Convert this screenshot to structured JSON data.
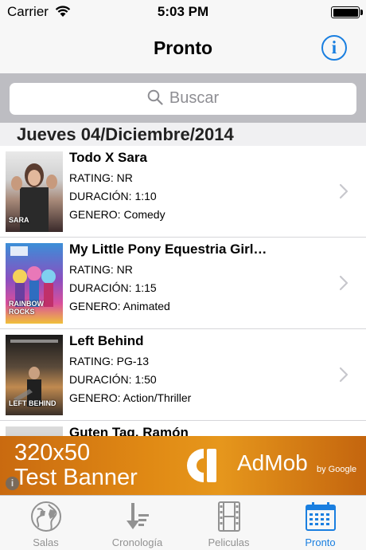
{
  "status_bar": {
    "carrier": "Carrier",
    "time": "5:03 PM"
  },
  "nav": {
    "title": "Pronto",
    "info_icon": "info-circle-icon"
  },
  "search": {
    "placeholder": "Buscar"
  },
  "section": {
    "header": "Jueves 04/Diciembre/2014"
  },
  "movies": [
    {
      "title": "Todo X Sara",
      "rating": "RATING: NR",
      "duration": "DURACIÓN: 1:10",
      "genre": "GENERO: Comedy",
      "poster_text": "SARA"
    },
    {
      "title": "My Little Pony Equestria Girl…",
      "rating": "RATING: NR",
      "duration": "DURACIÓN: 1:15",
      "genre": "GENERO: Animated",
      "poster_text": "RAINBOW ROCKS"
    },
    {
      "title": "Left Behind",
      "rating": "RATING: PG-13",
      "duration": "DURACIÓN: 1:50",
      "genre": "GENERO: Action/Thriller",
      "poster_text": "LEFT BEHIND"
    },
    {
      "title": "Guten Tag, Ramón",
      "rating": "",
      "duration": "",
      "genre": "",
      "poster_text": ""
    }
  ],
  "ad": {
    "line1": "320x50",
    "line2": "Test Banner",
    "brand": "AdMob",
    "by": "by Google"
  },
  "tabs": [
    {
      "label": "Salas",
      "icon": "globe-icon"
    },
    {
      "label": "Cronología",
      "icon": "sort-timeline-icon"
    },
    {
      "label": "Peliculas",
      "icon": "film-icon"
    },
    {
      "label": "Pronto",
      "icon": "calendar-icon",
      "active": true
    }
  ],
  "colors": {
    "accent": "#1a7fe0",
    "tab_inactive": "#929292",
    "ad_orange": "#e08914"
  }
}
